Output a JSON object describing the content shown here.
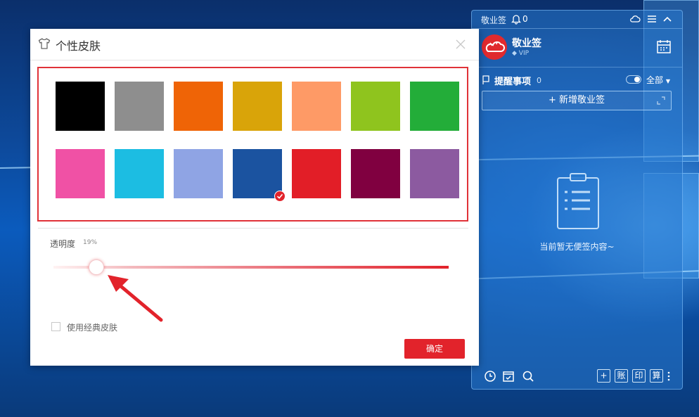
{
  "dialog": {
    "title": "个性皮肤",
    "swatches": [
      {
        "color": "#000000",
        "selected": false
      },
      {
        "color": "#8e8e8e",
        "selected": false
      },
      {
        "color": "#ef6406",
        "selected": false
      },
      {
        "color": "#d9a409",
        "selected": false
      },
      {
        "color": "#fe9a66",
        "selected": false
      },
      {
        "color": "#8fc41e",
        "selected": false
      },
      {
        "color": "#23ad39",
        "selected": false
      },
      {
        "color": "#f051a5",
        "selected": false
      },
      {
        "color": "#1cbde2",
        "selected": false
      },
      {
        "color": "#8fa4e4",
        "selected": false
      },
      {
        "color": "#1b53a0",
        "selected": true
      },
      {
        "color": "#e21e27",
        "selected": false
      },
      {
        "color": "#800040",
        "selected": false
      },
      {
        "color": "#8c5aa0",
        "selected": false
      }
    ],
    "opacity_label": "透明度",
    "opacity_value": "19%",
    "classic_skin_label": "使用经典皮肤",
    "classic_skin_checked": false,
    "confirm_label": "确定",
    "accent_color": "#e2232b"
  },
  "app": {
    "name": "敬业签",
    "bell_count": "0",
    "profile_name": "敬业签",
    "vip_label": "VIP",
    "reminder_label": "提醒事项",
    "reminder_count": "0",
    "filter_label": "全部",
    "add_label": "+ 新增敬业签",
    "empty_text": "当前暂无便签内容~",
    "bottom_buttons": [
      "账",
      "印",
      "算"
    ]
  }
}
